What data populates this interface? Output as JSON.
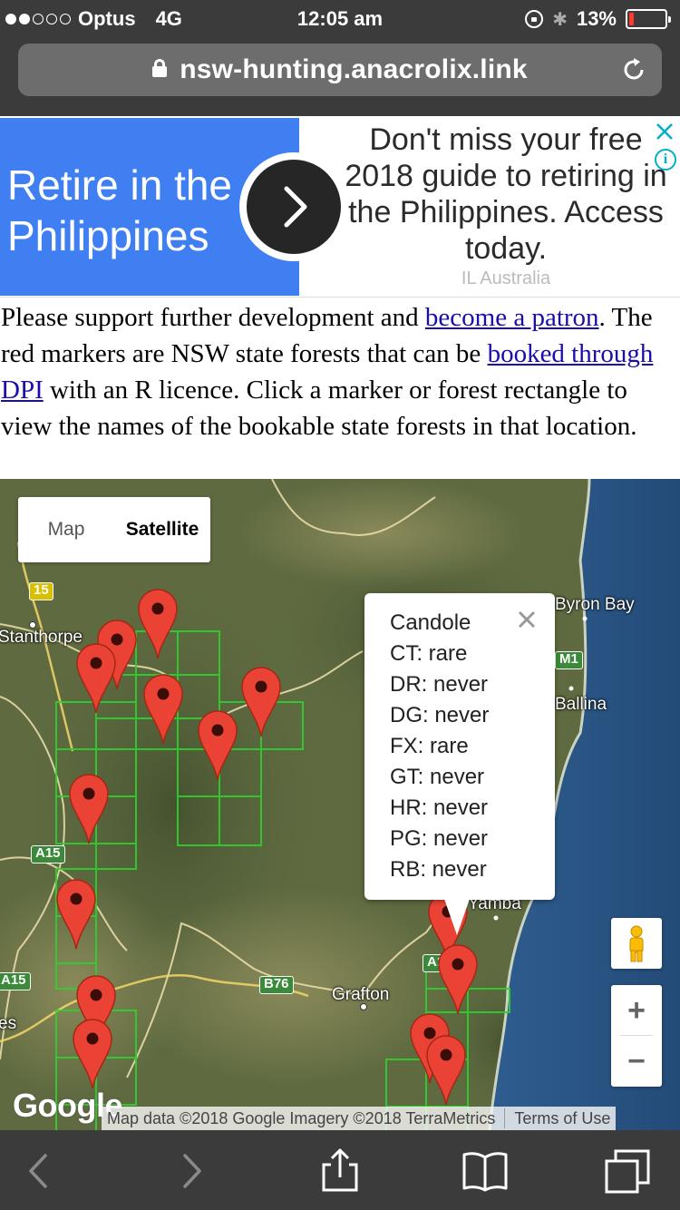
{
  "status_bar": {
    "carrier": "Optus",
    "network": "4G",
    "time": "12:05 am",
    "battery": "13%",
    "battery_level": 0.13,
    "signal_bars_filled": 2,
    "signal_bars_total": 5
  },
  "browser": {
    "url": "nsw-hunting.anacrolix.link"
  },
  "ad": {
    "title": "Retire in the\nPhilippines",
    "copy": "Don't miss your free 2018 guide to retiring in the Philippines. Access today.",
    "sponsor": "IL Australia",
    "colors": {
      "panel": "#3f7ff1",
      "button": "#262626"
    }
  },
  "intro": {
    "text1": "Please support further development and ",
    "link_patron": "become a patron",
    "text2": ". The red markers are NSW state forests that can be ",
    "link_booked": "booked through DPI",
    "text3": " with an R licence. Click a marker or forest rectangle to view the names of the bookable state forests in that location."
  },
  "map": {
    "type_buttons": {
      "map": "Map",
      "satellite": "Satellite",
      "selected": "Satellite"
    },
    "labels": {
      "stanthorpe": "Stanthorpe",
      "byron_bay": "Byron Bay",
      "ballina": "Ballina",
      "grafton": "Grafton",
      "yamba": "Yamba",
      "partial_left": "es"
    },
    "shields": {
      "r15": "15",
      "a15_upper": "A15",
      "a15_lower": "A15",
      "m1": "M1",
      "b76": "B76",
      "a1": "A1"
    },
    "infowindow": {
      "title": "Candole",
      "rows": [
        "CT: rare",
        "DR: never",
        "DG: never",
        "FX: rare",
        "GT: never",
        "HR: never",
        "PG: never",
        "RB: never"
      ]
    },
    "zoom": {
      "in": "+",
      "out": "−"
    },
    "google_logo": "Google",
    "attribution": "Map data ©2018 Google Imagery ©2018 TerraMetrics",
    "terms": "Terms of Use",
    "marker_color": "#ea4335"
  }
}
